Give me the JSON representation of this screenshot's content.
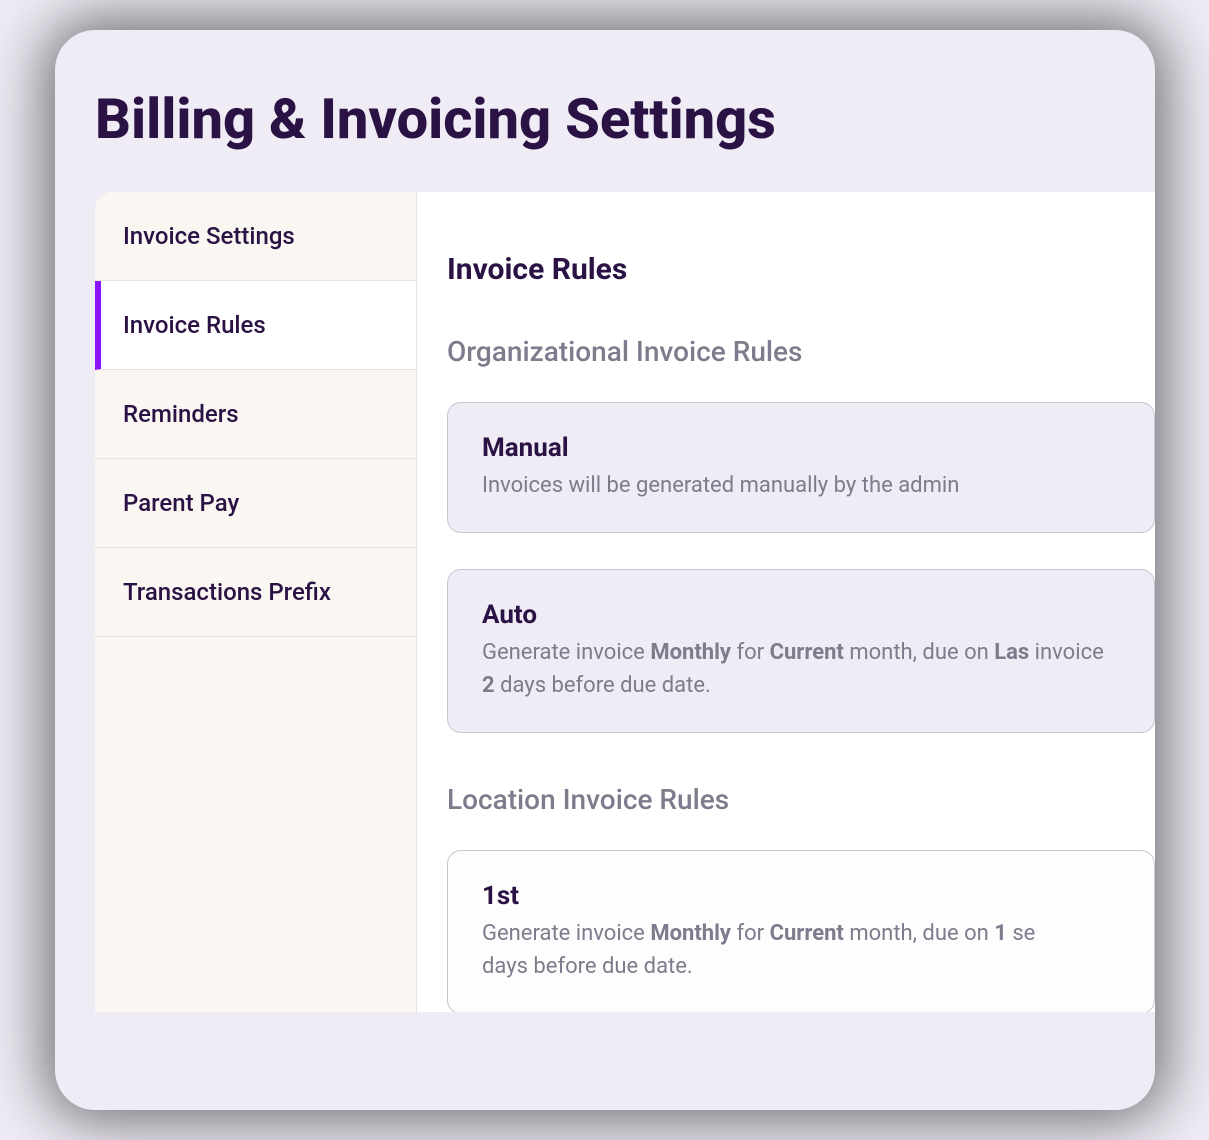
{
  "page": {
    "title": "Billing & Invoicing Settings"
  },
  "sidebar": {
    "items": [
      {
        "label": "Invoice Settings"
      },
      {
        "label": "Invoice Rules"
      },
      {
        "label": "Reminders"
      },
      {
        "label": "Parent Pay"
      },
      {
        "label": "Transactions Prefix"
      }
    ],
    "activeIndex": 1
  },
  "content": {
    "title": "Invoice Rules",
    "sections": {
      "org": {
        "heading": "Organizational Invoice Rules",
        "rules": [
          {
            "title": "Manual",
            "desc": {
              "t0": "Invoices will be generated manually by the admin"
            }
          },
          {
            "title": "Auto",
            "desc": {
              "t0": "Generate invoice ",
              "b0": "Monthly",
              "t1": " for ",
              "b1": "Current",
              "t2": " month, due on ",
              "b2": "Las",
              "t3": " invoice ",
              "b3": "2",
              "t4": " days before due date."
            }
          }
        ]
      },
      "loc": {
        "heading": "Location Invoice Rules",
        "rules": [
          {
            "title": "1st",
            "desc": {
              "t0": "Generate invoice ",
              "b0": "Monthly",
              "t1": " for ",
              "b1": "Current",
              "t2": " month, due on ",
              "b2": "1",
              "t3": " se",
              "t4": " days before due date."
            }
          }
        ]
      }
    }
  }
}
